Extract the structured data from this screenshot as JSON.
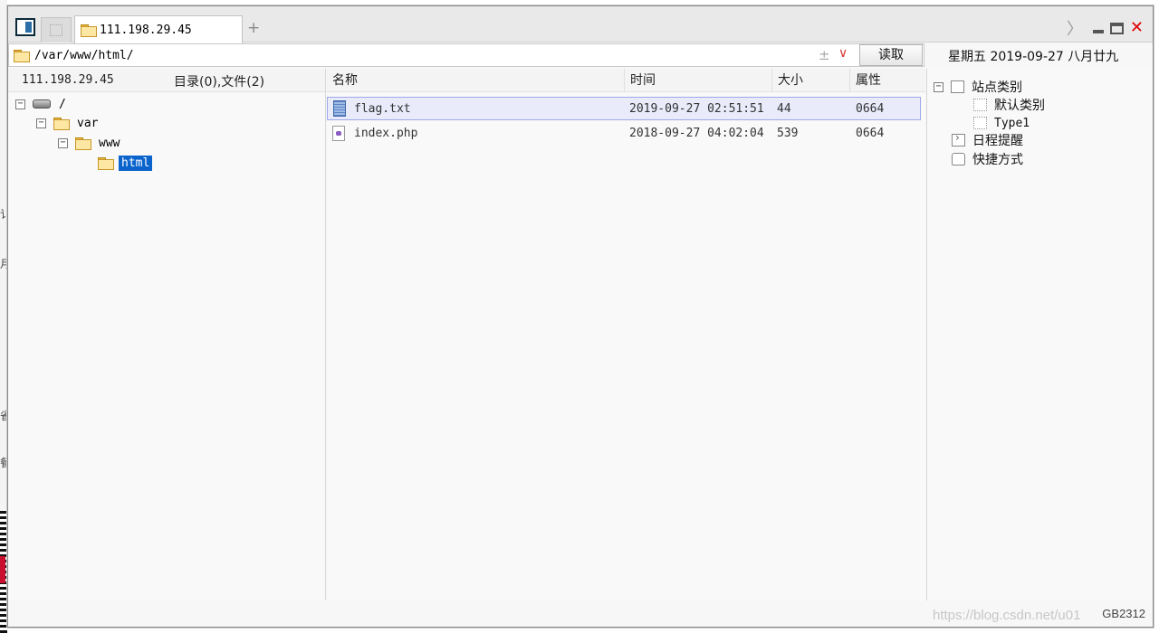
{
  "tabs": [
    {
      "label": "111.198.29.45"
    }
  ],
  "address": {
    "path": "/var/www/html/",
    "plus_minus": "±",
    "dropdown": "∨",
    "read_button": "读取"
  },
  "date_display": "星期五 2019-09-27 八月廿九",
  "left_panel": {
    "host": "111.198.29.45",
    "counts": "目录(0),文件(2)",
    "tree": [
      {
        "label": "/",
        "expander": "−"
      },
      {
        "label": "var",
        "expander": "−"
      },
      {
        "label": "www",
        "expander": "−"
      },
      {
        "label": "html",
        "selected": true
      }
    ]
  },
  "file_list": {
    "columns": [
      "名称",
      "时间",
      "大小",
      "属性"
    ],
    "rows": [
      {
        "name": "flag.txt",
        "time": "2019-09-27 02:51:51",
        "size": "44",
        "attr": "0664",
        "icon": "text-file-icon"
      },
      {
        "name": "index.php",
        "time": "2018-09-27 04:02:04",
        "size": "539",
        "attr": "0664",
        "icon": "php-file-icon"
      }
    ]
  },
  "right_panel": {
    "site_category": "站点类别",
    "default_category": "默认类别",
    "type1": "Type1",
    "schedule": "日程提醒",
    "shortcuts": "快捷方式"
  },
  "encoding": "GB2312",
  "watermark": "https://blog.csdn.net/u01",
  "bg_chars": [
    "讠",
    "月",
    "省",
    "餐"
  ],
  "colors": {
    "selection": "#0a64cc",
    "close": "#e00000",
    "row_selected": "#e9ebfb"
  }
}
